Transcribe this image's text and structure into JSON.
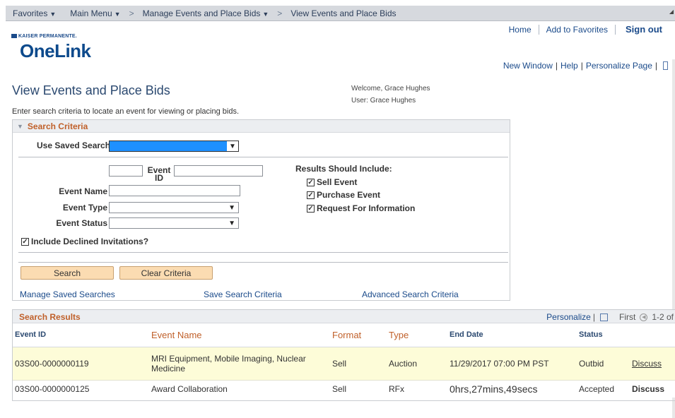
{
  "topnav": {
    "favorites": "Favorites",
    "main_menu": "Main Menu",
    "breadcrumb_1": "Manage Events and Place Bids",
    "breadcrumb_2": "View Events and Place Bids",
    "sep": ">"
  },
  "header": {
    "brand_small": "KAISER PERMANENTE.",
    "brand_big": "OneLink",
    "home": "Home",
    "add_favorites": "Add to Favorites",
    "sign_out": "Sign out"
  },
  "utility": {
    "new_window": "New Window",
    "help": "Help",
    "personalize_page": "Personalize Page",
    "pipe": "|"
  },
  "page": {
    "title": "View Events and Place Bids",
    "welcome": "Welcome, Grace Hughes",
    "user": "User: Grace Hughes",
    "instructions": "Enter search criteria to locate an event for viewing or placing bids."
  },
  "criteria": {
    "title": "Search Criteria",
    "use_saved_search": "Use Saved Search",
    "event_id_label": "Event ID",
    "event_name_label": "Event Name",
    "event_type_label": "Event Type",
    "event_status_label": "Event Status",
    "results_include": "Results Should Include:",
    "sell_event": "Sell Event",
    "purchase_event": "Purchase Event",
    "rfi": "Request For Information",
    "include_declined": "Include Declined Invitations?",
    "search_btn": "Search",
    "clear_btn": "Clear Criteria",
    "manage_saved": "Manage Saved Searches",
    "save_criteria": "Save Search Criteria",
    "advanced": "Advanced Search Criteria"
  },
  "results": {
    "title": "Search Results",
    "personalize": "Personalize",
    "first": "First",
    "range": "1-2 of",
    "columns": {
      "event_id": "Event ID",
      "event_name": "Event Name",
      "format": "Format",
      "type": "Type",
      "end_date": "End Date",
      "status": "Status"
    },
    "rows": [
      {
        "event_id": "03S00-0000000119",
        "event_name": "MRI Equipment, Mobile Imaging, Nuclear Medicine",
        "format": "Sell",
        "type": "Auction",
        "end_date": "11/29/2017 07:00 PM PST",
        "status": "Outbid",
        "discuss": "Discuss"
      },
      {
        "event_id": "03S00-0000000125",
        "event_name": "Award Collaboration",
        "format": "Sell",
        "type": "RFx",
        "end_date": "0hrs,27mins,49secs",
        "status": "Accepted",
        "discuss": "Discuss"
      }
    ]
  },
  "colors": {
    "accent_orange": "#c0602a",
    "link_blue": "#1a4a8a",
    "button_bg": "#fbdcb2",
    "status_red": "#e8291c"
  }
}
